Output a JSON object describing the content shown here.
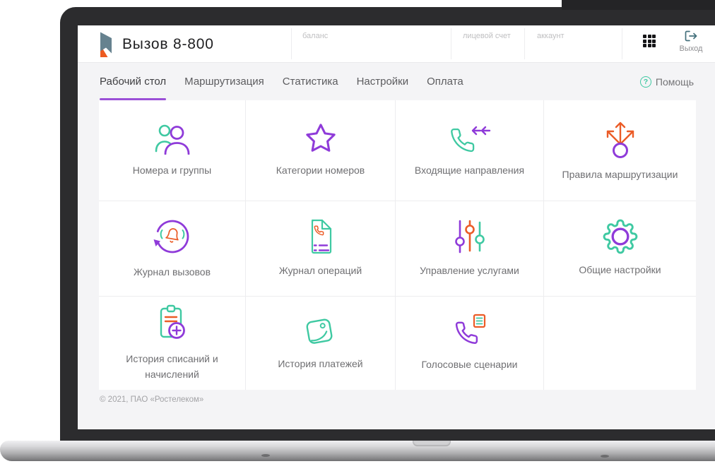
{
  "brand": {
    "title": "Вызов 8-800"
  },
  "header": {
    "fields": [
      {
        "label": "баланс"
      },
      {
        "label": "лицевой счет"
      },
      {
        "label": "аккаунт"
      }
    ],
    "logout": {
      "label": "Выход"
    }
  },
  "nav": {
    "tabs": [
      {
        "label": "Рабочий стол",
        "active": true
      },
      {
        "label": "Маршрутизация",
        "active": false
      },
      {
        "label": "Статистика",
        "active": false
      },
      {
        "label": "Настройки",
        "active": false
      },
      {
        "label": "Оплата",
        "active": false
      }
    ],
    "help": {
      "label": "Помощь",
      "icon_glyph": "?"
    }
  },
  "tiles": [
    {
      "label": "Номера и группы",
      "icon": "users-icon"
    },
    {
      "label": "Категории номеров",
      "icon": "star-icon"
    },
    {
      "label": "Входящие направления",
      "icon": "incoming-call-icon"
    },
    {
      "label": "Правила маршрутизации",
      "icon": "routing-arrows-icon"
    },
    {
      "label": "Журнал вызовов",
      "icon": "call-log-icon"
    },
    {
      "label": "Журнал операций",
      "icon": "operations-log-icon"
    },
    {
      "label": "Управление услугами",
      "icon": "sliders-icon"
    },
    {
      "label": "Общие настройки",
      "icon": "gear-icon"
    },
    {
      "label": "История списаний и начислений",
      "icon": "clipboard-plus-icon"
    },
    {
      "label": "История платежей",
      "icon": "wallet-icon"
    },
    {
      "label": "Голосовые сценарии",
      "icon": "voice-script-icon"
    }
  ],
  "footer": {
    "copyright": "© 2021, ПАО «Ростелеком»"
  },
  "colors": {
    "purple": "#8f3bd9",
    "teal": "#3fc9a2",
    "orange": "#eb5c27",
    "active_tab_underline": "#9a4fd6"
  }
}
